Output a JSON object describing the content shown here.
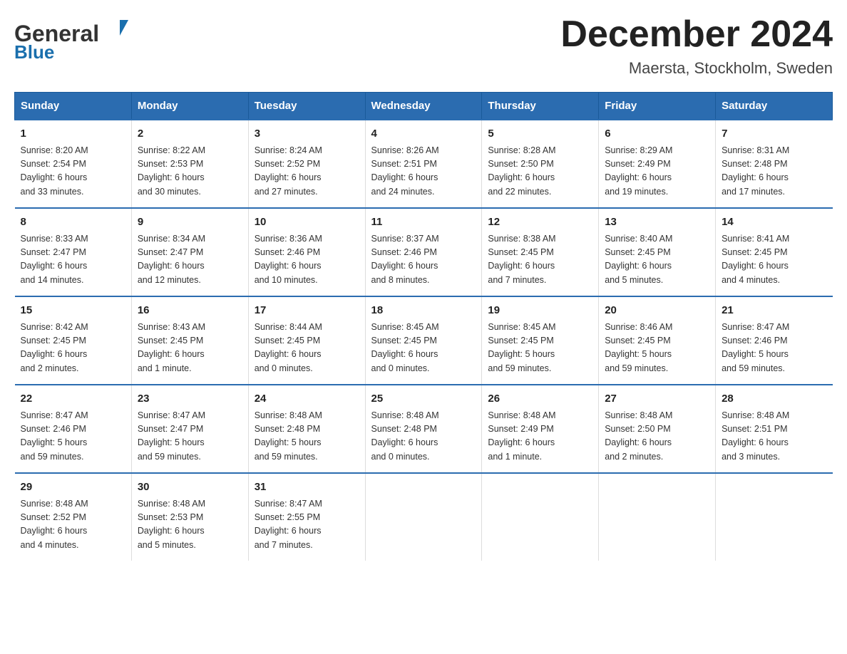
{
  "header": {
    "logo_general": "General",
    "logo_blue": "Blue",
    "title": "December 2024",
    "subtitle": "Maersta, Stockholm, Sweden"
  },
  "calendar": {
    "days_of_week": [
      "Sunday",
      "Monday",
      "Tuesday",
      "Wednesday",
      "Thursday",
      "Friday",
      "Saturday"
    ],
    "weeks": [
      [
        {
          "day": "1",
          "sunrise": "8:20 AM",
          "sunset": "2:54 PM",
          "daylight": "6 hours and 33 minutes."
        },
        {
          "day": "2",
          "sunrise": "8:22 AM",
          "sunset": "2:53 PM",
          "daylight": "6 hours and 30 minutes."
        },
        {
          "day": "3",
          "sunrise": "8:24 AM",
          "sunset": "2:52 PM",
          "daylight": "6 hours and 27 minutes."
        },
        {
          "day": "4",
          "sunrise": "8:26 AM",
          "sunset": "2:51 PM",
          "daylight": "6 hours and 24 minutes."
        },
        {
          "day": "5",
          "sunrise": "8:28 AM",
          "sunset": "2:50 PM",
          "daylight": "6 hours and 22 minutes."
        },
        {
          "day": "6",
          "sunrise": "8:29 AM",
          "sunset": "2:49 PM",
          "daylight": "6 hours and 19 minutes."
        },
        {
          "day": "7",
          "sunrise": "8:31 AM",
          "sunset": "2:48 PM",
          "daylight": "6 hours and 17 minutes."
        }
      ],
      [
        {
          "day": "8",
          "sunrise": "8:33 AM",
          "sunset": "2:47 PM",
          "daylight": "6 hours and 14 minutes."
        },
        {
          "day": "9",
          "sunrise": "8:34 AM",
          "sunset": "2:47 PM",
          "daylight": "6 hours and 12 minutes."
        },
        {
          "day": "10",
          "sunrise": "8:36 AM",
          "sunset": "2:46 PM",
          "daylight": "6 hours and 10 minutes."
        },
        {
          "day": "11",
          "sunrise": "8:37 AM",
          "sunset": "2:46 PM",
          "daylight": "6 hours and 8 minutes."
        },
        {
          "day": "12",
          "sunrise": "8:38 AM",
          "sunset": "2:45 PM",
          "daylight": "6 hours and 7 minutes."
        },
        {
          "day": "13",
          "sunrise": "8:40 AM",
          "sunset": "2:45 PM",
          "daylight": "6 hours and 5 minutes."
        },
        {
          "day": "14",
          "sunrise": "8:41 AM",
          "sunset": "2:45 PM",
          "daylight": "6 hours and 4 minutes."
        }
      ],
      [
        {
          "day": "15",
          "sunrise": "8:42 AM",
          "sunset": "2:45 PM",
          "daylight": "6 hours and 2 minutes."
        },
        {
          "day": "16",
          "sunrise": "8:43 AM",
          "sunset": "2:45 PM",
          "daylight": "6 hours and 1 minute."
        },
        {
          "day": "17",
          "sunrise": "8:44 AM",
          "sunset": "2:45 PM",
          "daylight": "6 hours and 0 minutes."
        },
        {
          "day": "18",
          "sunrise": "8:45 AM",
          "sunset": "2:45 PM",
          "daylight": "6 hours and 0 minutes."
        },
        {
          "day": "19",
          "sunrise": "8:45 AM",
          "sunset": "2:45 PM",
          "daylight": "5 hours and 59 minutes."
        },
        {
          "day": "20",
          "sunrise": "8:46 AM",
          "sunset": "2:45 PM",
          "daylight": "5 hours and 59 minutes."
        },
        {
          "day": "21",
          "sunrise": "8:47 AM",
          "sunset": "2:46 PM",
          "daylight": "5 hours and 59 minutes."
        }
      ],
      [
        {
          "day": "22",
          "sunrise": "8:47 AM",
          "sunset": "2:46 PM",
          "daylight": "5 hours and 59 minutes."
        },
        {
          "day": "23",
          "sunrise": "8:47 AM",
          "sunset": "2:47 PM",
          "daylight": "5 hours and 59 minutes."
        },
        {
          "day": "24",
          "sunrise": "8:48 AM",
          "sunset": "2:48 PM",
          "daylight": "5 hours and 59 minutes."
        },
        {
          "day": "25",
          "sunrise": "8:48 AM",
          "sunset": "2:48 PM",
          "daylight": "6 hours and 0 minutes."
        },
        {
          "day": "26",
          "sunrise": "8:48 AM",
          "sunset": "2:49 PM",
          "daylight": "6 hours and 1 minute."
        },
        {
          "day": "27",
          "sunrise": "8:48 AM",
          "sunset": "2:50 PM",
          "daylight": "6 hours and 2 minutes."
        },
        {
          "day": "28",
          "sunrise": "8:48 AM",
          "sunset": "2:51 PM",
          "daylight": "6 hours and 3 minutes."
        }
      ],
      [
        {
          "day": "29",
          "sunrise": "8:48 AM",
          "sunset": "2:52 PM",
          "daylight": "6 hours and 4 minutes."
        },
        {
          "day": "30",
          "sunrise": "8:48 AM",
          "sunset": "2:53 PM",
          "daylight": "6 hours and 5 minutes."
        },
        {
          "day": "31",
          "sunrise": "8:47 AM",
          "sunset": "2:55 PM",
          "daylight": "6 hours and 7 minutes."
        },
        null,
        null,
        null,
        null
      ]
    ],
    "labels": {
      "sunrise": "Sunrise:",
      "sunset": "Sunset:",
      "daylight": "Daylight:"
    }
  }
}
